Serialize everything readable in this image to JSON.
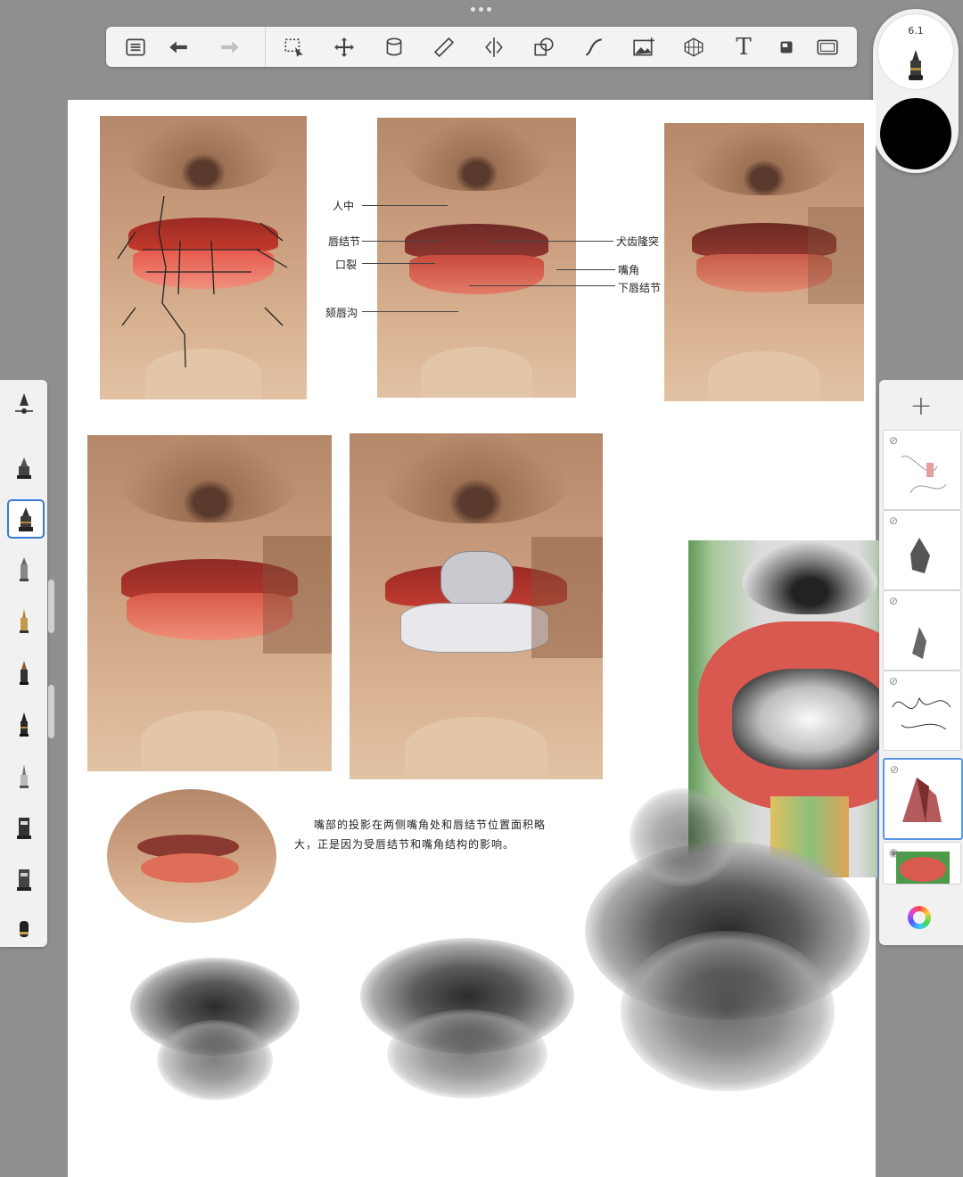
{
  "toolbar": {
    "items": [
      "menu-icon",
      "undo-icon",
      "redo-icon",
      "selection-icon",
      "transform-icon",
      "fill-icon",
      "ruler-icon",
      "symmetry-icon",
      "shapes-icon",
      "stroke-icon",
      "image-import-icon",
      "perspective-icon",
      "text-icon",
      "flipbook-icon",
      "fullscreen-icon"
    ]
  },
  "brush_size": {
    "value": "6.1"
  },
  "current_color": "#000000",
  "artwork": {
    "annotations_left": [
      "人中",
      "唇结节",
      "口裂",
      "颏唇沟"
    ],
    "annotations_right": [
      "犬齿隆突",
      "嘴角",
      "下唇结节"
    ],
    "caption_line1": "嘴部的投影在两侧嘴角处和唇结节位置面积略",
    "caption_line2": "大，正是因为受唇结节和嘴角结构的影响。"
  },
  "brushes": [
    "fill-pen-icon",
    "pencil-icon",
    "technical-pen-icon",
    "marker-icon",
    "felt-pen-icon",
    "fountain-pen-icon",
    "paint-brush-icon",
    "ink-brush-icon",
    "airbrush-icon",
    "bucket-brush-icon",
    "bucket-brush-2-icon",
    "eraser-icon"
  ],
  "layers": {
    "add_label": "+",
    "count": 6
  }
}
